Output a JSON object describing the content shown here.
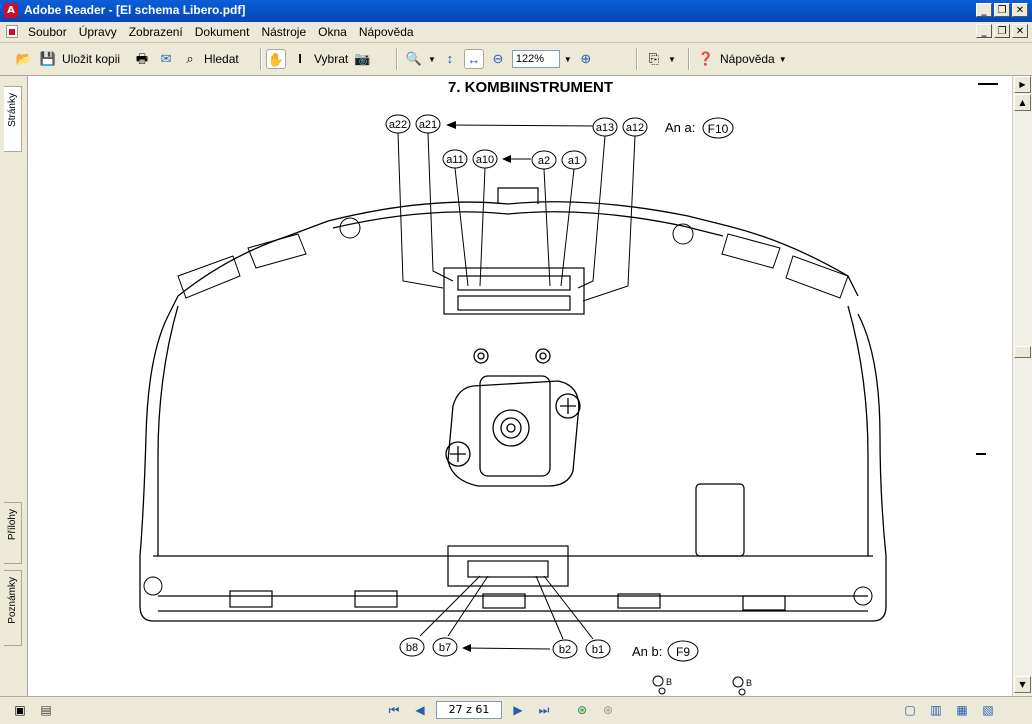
{
  "window": {
    "title": "Adobe Reader - [El schema Libero.pdf]",
    "app_icon": "adobe-reader-icon"
  },
  "menu": {
    "items": [
      "Soubor",
      "Úpravy",
      "Zobrazení",
      "Dokument",
      "Nástroje",
      "Okna",
      "Nápověda"
    ]
  },
  "toolbar": {
    "save_copy_label": "Uložit kopii",
    "search_label": "Hledat",
    "select_label": "Vybrat",
    "zoom_value": "122%",
    "help_label": "Nápověda"
  },
  "side_tabs": {
    "pages": "Stránky",
    "attachments": "Přílohy",
    "comments": "Poznámky"
  },
  "document": {
    "heading": "7. KOMBIINSTRUMENT",
    "top_connector": {
      "callout_row1": [
        "a22",
        "a21",
        "a13",
        "a12"
      ],
      "callout_row2": [
        "a11",
        "a10",
        "a2",
        "a1"
      ],
      "label": "An a:",
      "connector": "F10"
    },
    "bottom_connector": {
      "callouts": [
        "b8",
        "b7",
        "b2",
        "b1"
      ],
      "label": "An b:",
      "connector": "F9"
    },
    "footer_marks": [
      "B",
      "B"
    ]
  },
  "status": {
    "page_indicator": "27 z 61"
  }
}
